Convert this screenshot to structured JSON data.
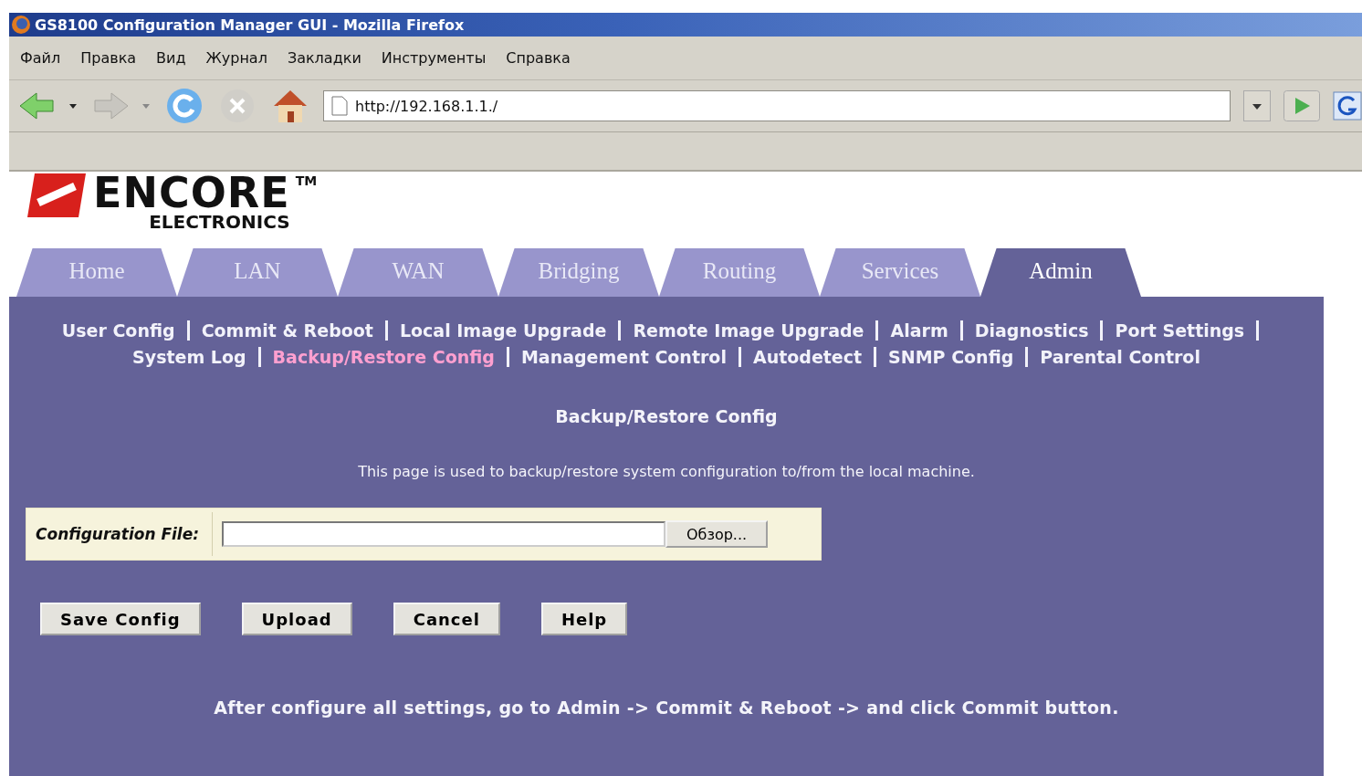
{
  "window": {
    "title": "GS8100 Configuration Manager GUI - Mozilla Firefox"
  },
  "menu": [
    "Файл",
    "Правка",
    "Вид",
    "Журнал",
    "Закладки",
    "Инструменты",
    "Справка"
  ],
  "address": {
    "value": "http://192.168.1.1./"
  },
  "logo": {
    "brand": "ENCORE",
    "trademark": "TM",
    "subtitle": "ELECTRONICS"
  },
  "tabs": [
    {
      "label": "Home",
      "selected": false
    },
    {
      "label": "LAN",
      "selected": false
    },
    {
      "label": "WAN",
      "selected": false
    },
    {
      "label": "Bridging",
      "selected": false
    },
    {
      "label": "Routing",
      "selected": false
    },
    {
      "label": "Services",
      "selected": false
    },
    {
      "label": "Admin",
      "selected": true
    }
  ],
  "link_rows": [
    [
      {
        "label": "User Config",
        "selected": false
      },
      {
        "label": "Commit & Reboot",
        "selected": false
      },
      {
        "label": "Local Image Upgrade",
        "selected": false
      },
      {
        "label": "Remote Image Upgrade",
        "selected": false
      },
      {
        "label": "Alarm",
        "selected": false
      },
      {
        "label": "Diagnostics",
        "selected": false
      },
      {
        "label": "Port Settings",
        "selected": false
      }
    ],
    [
      {
        "label": "System Log",
        "selected": false
      },
      {
        "label": "Backup/Restore Config",
        "selected": true
      },
      {
        "label": "Management Control",
        "selected": false
      },
      {
        "label": "Autodetect",
        "selected": false
      },
      {
        "label": "SNMP Config",
        "selected": false
      },
      {
        "label": "Parental Control",
        "selected": false
      }
    ]
  ],
  "heading": "Backup/Restore Config",
  "description": "This page is used to backup/restore system configuration to/from the local machine.",
  "file_field": {
    "label": "Configuration File:",
    "browse_button": "Обзор..."
  },
  "buttons": [
    "Save Config",
    "Upload",
    "Cancel",
    "Help"
  ],
  "note": "After configure all settings, go to Admin -> Commit & Reboot -> and click Commit button."
}
